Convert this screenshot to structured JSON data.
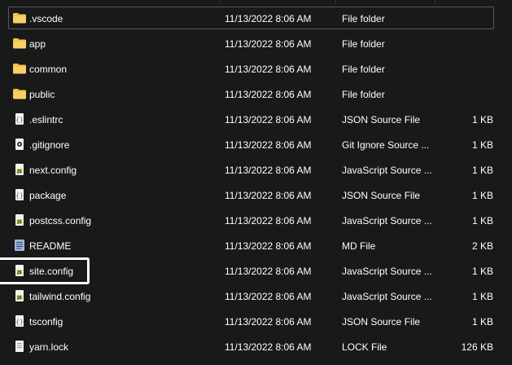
{
  "files": [
    {
      "name": ".vscode",
      "date": "11/13/2022 8:06 AM",
      "type": "File folder",
      "size": "",
      "icon": "folder-icon"
    },
    {
      "name": "app",
      "date": "11/13/2022 8:06 AM",
      "type": "File folder",
      "size": "",
      "icon": "folder-icon"
    },
    {
      "name": "common",
      "date": "11/13/2022 8:06 AM",
      "type": "File folder",
      "size": "",
      "icon": "folder-icon"
    },
    {
      "name": "public",
      "date": "11/13/2022 8:06 AM",
      "type": "File folder",
      "size": "",
      "icon": "folder-icon"
    },
    {
      "name": ".eslintrc",
      "date": "11/13/2022 8:06 AM",
      "type": "JSON Source File",
      "size": "1 KB",
      "icon": "json-file-icon"
    },
    {
      "name": ".gitignore",
      "date": "11/13/2022 8:06 AM",
      "type": "Git Ignore Source ...",
      "size": "1 KB",
      "icon": "gitignore-file-icon"
    },
    {
      "name": "next.config",
      "date": "11/13/2022 8:06 AM",
      "type": "JavaScript Source ...",
      "size": "1 KB",
      "icon": "js-file-icon"
    },
    {
      "name": "package",
      "date": "11/13/2022 8:06 AM",
      "type": "JSON Source File",
      "size": "1 KB",
      "icon": "json-file-icon"
    },
    {
      "name": "postcss.config",
      "date": "11/13/2022 8:06 AM",
      "type": "JavaScript Source ...",
      "size": "1 KB",
      "icon": "js-file-icon"
    },
    {
      "name": "README",
      "date": "11/13/2022 8:06 AM",
      "type": "MD File",
      "size": "2 KB",
      "icon": "markdown-file-icon"
    },
    {
      "name": "site.config",
      "date": "11/13/2022 8:06 AM",
      "type": "JavaScript Source ...",
      "size": "1 KB",
      "icon": "js-file-icon"
    },
    {
      "name": "tailwind.config",
      "date": "11/13/2022 8:06 AM",
      "type": "JavaScript Source ...",
      "size": "1 KB",
      "icon": "js-file-icon"
    },
    {
      "name": "tsconfig",
      "date": "11/13/2022 8:06 AM",
      "type": "JSON Source File",
      "size": "1 KB",
      "icon": "json-file-icon"
    },
    {
      "name": "yarn.lock",
      "date": "11/13/2022 8:06 AM",
      "type": "LOCK File",
      "size": "126 KB",
      "icon": "lock-file-icon"
    }
  ],
  "colors": {
    "background": "#191919",
    "text": "#ffffff",
    "folder": "#f3c244",
    "js_badge": "#d8d36a",
    "highlight": "#ffffff"
  }
}
